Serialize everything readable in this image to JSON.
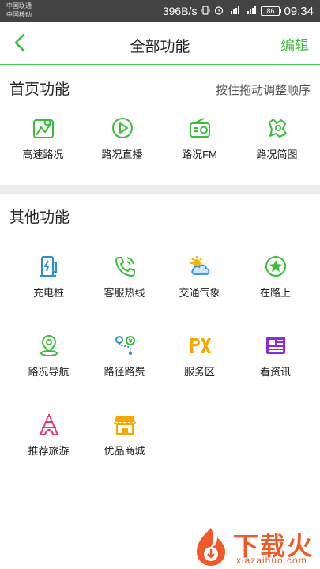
{
  "status_bar": {
    "carrier_1": "中国联通",
    "carrier_2": "中国移动",
    "net_speed": "396B/s",
    "battery": "86",
    "time": "09:34"
  },
  "header": {
    "title": "全部功能",
    "edit_label": "编辑"
  },
  "home_section": {
    "title": "首页功能",
    "hint": "按住拖动调整顺序",
    "items": [
      {
        "label": "高速路况",
        "icon": "highway-map-icon"
      },
      {
        "label": "路况直播",
        "icon": "play-circle-icon"
      },
      {
        "label": "路况FM",
        "icon": "radio-icon"
      },
      {
        "label": "路况简图",
        "icon": "simple-map-icon"
      }
    ]
  },
  "other_section": {
    "title": "其他功能",
    "items": [
      {
        "label": "充电桩",
        "icon": "charging-pile-icon"
      },
      {
        "label": "客服热线",
        "icon": "phone-hotline-icon"
      },
      {
        "label": "交通气象",
        "icon": "weather-icon"
      },
      {
        "label": "在路上",
        "icon": "star-badge-icon"
      },
      {
        "label": "路况导航",
        "icon": "navigation-pin-icon"
      },
      {
        "label": "路径路费",
        "icon": "route-fee-icon"
      },
      {
        "label": "服务区",
        "icon": "px-service-icon"
      },
      {
        "label": "看资讯",
        "icon": "news-icon"
      },
      {
        "label": "推荐旅游",
        "icon": "eiffel-tower-icon"
      },
      {
        "label": "优品商城",
        "icon": "shop-icon"
      }
    ]
  },
  "watermark": {
    "brand": "下载火",
    "url": "xiazaihuo.com"
  },
  "colors": {
    "accent_green": "#3bbd3b",
    "status_bar": "#434343",
    "divider": "#ececec"
  }
}
